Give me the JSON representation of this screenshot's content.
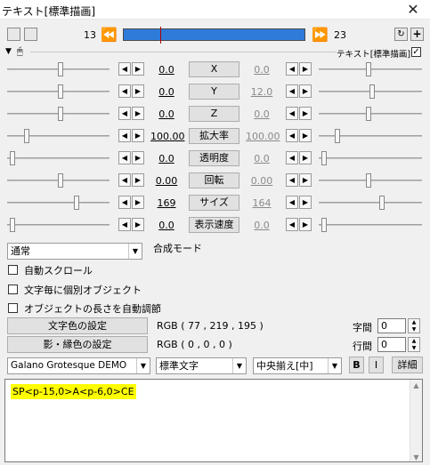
{
  "window": {
    "title": "テキスト[標準描画]",
    "close_label": "✕"
  },
  "frame": {
    "start": "13",
    "end": "23"
  },
  "object_label": "テキスト[標準描画]",
  "params": [
    {
      "label": "X",
      "left": "0.0",
      "right": "0.0",
      "left_pos": 0.52,
      "right_pos": 0.48
    },
    {
      "label": "Y",
      "left": "0.0",
      "right": "12.0",
      "left_pos": 0.52,
      "right_pos": 0.52
    },
    {
      "label": "Z",
      "left": "0.0",
      "right": "0.0",
      "left_pos": 0.52,
      "right_pos": 0.48
    },
    {
      "label": "拡大率",
      "left": "100.00",
      "right": "100.00",
      "left_pos": 0.17,
      "right_pos": 0.16
    },
    {
      "label": "透明度",
      "left": "0.0",
      "right": "0.0",
      "left_pos": 0.03,
      "right_pos": 0.03
    },
    {
      "label": "回転",
      "left": "0.00",
      "right": "0.00",
      "left_pos": 0.52,
      "right_pos": 0.48
    },
    {
      "label": "サイズ",
      "left": "169",
      "right": "164",
      "left_pos": 0.69,
      "right_pos": 0.62
    },
    {
      "label": "表示速度",
      "left": "0.0",
      "right": "0.0",
      "left_pos": 0.03,
      "right_pos": 0.03
    }
  ],
  "blend": {
    "value": "通常",
    "label": "合成モード"
  },
  "checkboxes": [
    "自動スクロール",
    "文字毎に個別オブジェクト",
    "オブジェクトの長さを自動調節"
  ],
  "text_color": {
    "button": "文字色の設定",
    "value": "RGB ( 77 , 219 , 195 )",
    "hex": "#4ddbc3"
  },
  "shadow_color": {
    "button": "影・縁色の設定",
    "value": "RGB ( 0 , 0 , 0 )",
    "hex": "#000000"
  },
  "spacing": {
    "char_label": "字間",
    "char_value": "0",
    "line_label": "行間",
    "line_value": "0"
  },
  "font": {
    "family": "Galano Grotesque DEMO",
    "style": "標準文字",
    "align": "中央揃え[中]"
  },
  "format": {
    "bold": "B",
    "italic": "I",
    "detail": "詳細"
  },
  "text_content": "SP<p-15,0>A<p-6,0>CE",
  "colors": {
    "timeline": "#2f7bd9",
    "highlight": "#ffff00"
  }
}
